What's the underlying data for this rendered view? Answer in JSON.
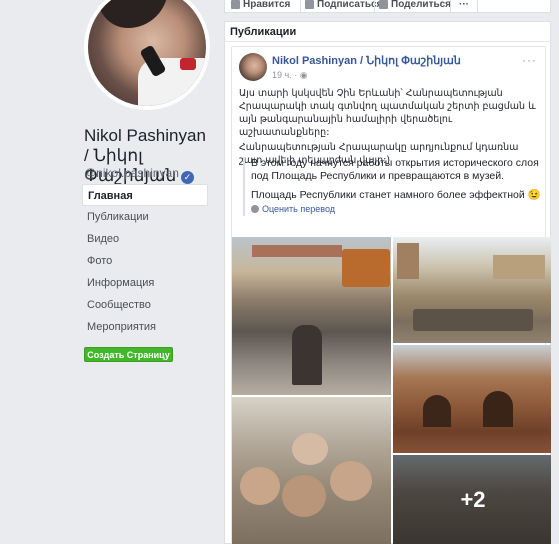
{
  "profile": {
    "name": "Nikol Pashinyan / Նիկոլ Փաշինյան",
    "handle": "@nikol.pashinyan"
  },
  "nav": {
    "items": [
      {
        "label": "Главная",
        "active": true
      },
      {
        "label": "Публикации",
        "active": false
      },
      {
        "label": "Видео",
        "active": false
      },
      {
        "label": "Фото",
        "active": false
      },
      {
        "label": "Информация",
        "active": false
      },
      {
        "label": "Сообщество",
        "active": false
      },
      {
        "label": "Мероприятия",
        "active": false
      }
    ],
    "create_page_label": "Создать Страницу"
  },
  "topbar": {
    "like_label": "Нравится",
    "follow_label": "Подписаться",
    "share_label": "Поделиться",
    "more_label": "···"
  },
  "publications": {
    "header": "Публикации",
    "post": {
      "author": "Nikol Pashinyan / Նիկոլ Փաշինյան",
      "time": "19 ч.",
      "more": "···",
      "text_hy_1": "Այս տարի կսկսվեն Չին Երևանի՝ Հանրապետության Հրապարակի տակ գտնվող պատմական շերտի բացման և այն թանգարանային համալիրի վերածելու աշխատանքները:",
      "text_hy_2": "Հանրապետության Հրապարակը արդյունքում կդառնա շատ ավելի տեսարժան վայր:)",
      "text_ru_1": "В этом году начнутся работы открытия исторического слоя под Площадь Республики и превращаются в музей.",
      "text_ru_2": "Площадь Республики станет намного более эффектной 😉",
      "rate_translation": "Оценить перевод",
      "more_photos": "+2"
    }
  },
  "colors": {
    "link": "#365899",
    "create_button": "#42b72a",
    "page_bg": "#e9ebee"
  }
}
